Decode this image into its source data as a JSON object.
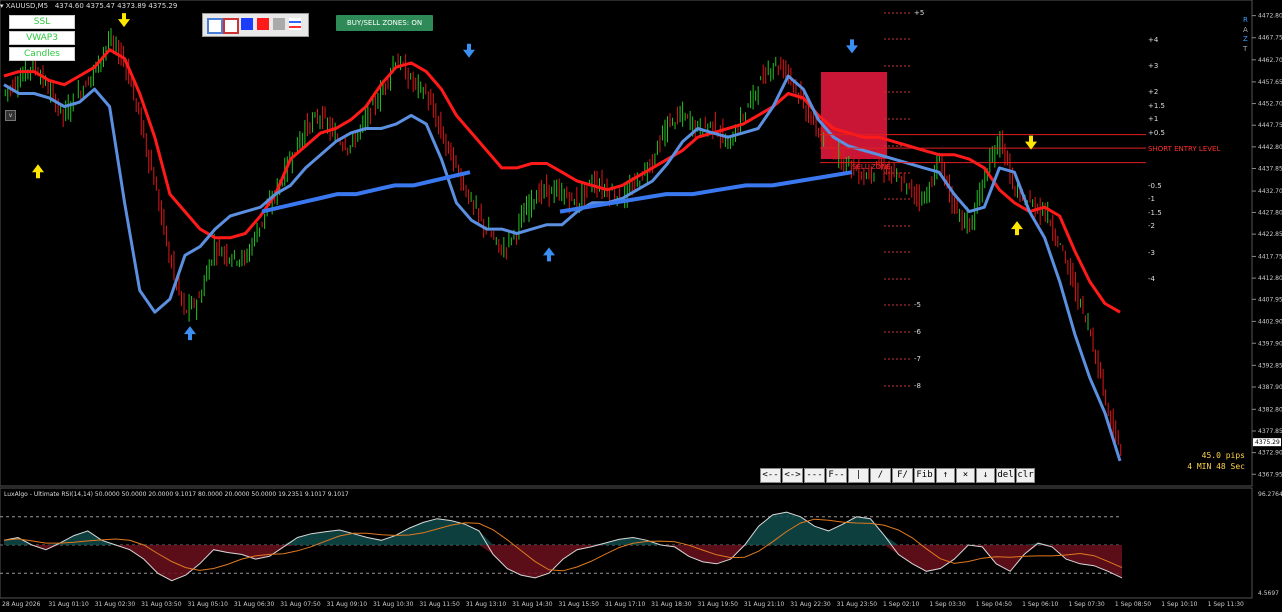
{
  "header": {
    "symbol": "XAUUSD,M5",
    "ohlc": "4374.60 4375.47 4373.89 4375.29"
  },
  "indicator_buttons": [
    "SSL",
    "VWAP3",
    "Candles"
  ],
  "zones_button": "BUY/SELL ZONES: ON",
  "color_swatches": [
    "#ffffff",
    "#ffffff",
    "#1a3cff",
    "#ff1a1a",
    "#bbbbbb",
    "#ff3333"
  ],
  "fib_levels_left": [
    "+5",
    "-5",
    "-6",
    "-7",
    "-8"
  ],
  "fib_levels_right": [
    "+4",
    "+3",
    "+2",
    "+1.5",
    "+1",
    "+0.5",
    "-0.5",
    "-1",
    "-1.5",
    "-2",
    "-3",
    "-4"
  ],
  "short_entry_label": "SHORT ENTRY LEVEL",
  "sell_zone_label": "SELL ZONE",
  "pips": "45.0 pips",
  "timer": "4 MIN 48 Sec",
  "right_fragments": [
    "R",
    "A",
    "Z",
    "T"
  ],
  "toolbar": [
    "<--",
    "<->",
    "---",
    "F--",
    "|",
    "/",
    "F/",
    "Fib",
    "↑",
    "×",
    "↓",
    "del",
    "clr"
  ],
  "rsi_label": "LuxAlgo - Ultimate RSI(14,14) 50.0000 50.0000 20.0000 9.1017 80.0000 20.0000 50.0000 19.2351 9.1017 9.1017",
  "rsi_scale": [
    "96.2764",
    "4.5697"
  ],
  "chart_data": {
    "type": "line",
    "title": "XAUUSD,M5",
    "price_axis": [
      "4472.80",
      "4467.75",
      "4462.70",
      "4457.65",
      "4452.70",
      "4447.75",
      "4442.80",
      "4437.85",
      "4432.70",
      "4427.80",
      "4422.85",
      "4417.75",
      "4412.80",
      "4407.95",
      "4402.90",
      "4397.90",
      "4392.85",
      "4387.90",
      "4382.80",
      "4377.85",
      "4372.90",
      "4367.95"
    ],
    "current_price": "4375.29",
    "ylim": [
      4365.5,
      4475.0
    ],
    "x_labels": [
      "28 Aug 2026",
      "31 Aug 01:10",
      "31 Aug 02:30",
      "31 Aug 03:50",
      "31 Aug 05:10",
      "31 Aug 06:30",
      "31 Aug 07:50",
      "31 Aug 09:10",
      "31 Aug 10:30",
      "31 Aug 11:50",
      "31 Aug 13:10",
      "31 Aug 14:30",
      "31 Aug 15:50",
      "31 Aug 17:10",
      "31 Aug 18:30",
      "31 Aug 19:50",
      "31 Aug 21:10",
      "31 Aug 22:30",
      "31 Aug 23:50",
      "1 Sep 02:10",
      "1 Sep 03:30",
      "1 Sep 04:50",
      "1 Sep 06:10",
      "1 Sep 07:30",
      "1 Sep 08:50",
      "1 Sep 10:10",
      "1 Sep 11:30"
    ],
    "series": [
      {
        "name": "SSL",
        "values": [
          4459,
          4460,
          4460,
          4458,
          4457,
          4459,
          4461,
          4465,
          4463,
          4455,
          4445,
          4432,
          4428,
          4424,
          4422,
          4422,
          4423,
          4427,
          4432,
          4440,
          4443,
          4446,
          4447,
          4449,
          4452,
          4457,
          4461,
          4462,
          4460,
          4456,
          4450,
          4446,
          4442,
          4438,
          4438,
          4439,
          4439,
          4437,
          4435,
          4434,
          4433,
          4434,
          4436,
          4438,
          4440,
          4442,
          4445,
          4446,
          4447,
          4448,
          4450,
          4452,
          4455,
          4454,
          4450,
          4447,
          4446,
          4445,
          4445,
          4444,
          4443,
          4442,
          4441,
          4441,
          4440,
          4438,
          4433,
          4430,
          4428,
          4429,
          4427,
          4419,
          4412,
          4407,
          4405
        ]
      },
      {
        "name": "VWAP3",
        "values": [
          4457,
          4455,
          4455,
          4454,
          4452,
          4453,
          4456,
          4452,
          4430,
          4410,
          4405,
          4408,
          4418,
          4420,
          4424,
          4427,
          4428,
          4429,
          4432,
          4434,
          4438,
          4441,
          4444,
          4446,
          4447,
          4447,
          4448,
          4450,
          4448,
          4440,
          4430,
          4426,
          4424,
          4424,
          4423,
          4424,
          4425,
          4425,
          4428,
          4430,
          4430,
          4431,
          4433,
          4435,
          4439,
          4444,
          4447,
          4446,
          4445,
          4446,
          4447,
          4452,
          4459,
          4456,
          4449,
          4445,
          4443,
          4442,
          4441,
          4440,
          4439,
          4438,
          4437,
          4432,
          4428,
          4429,
          4438,
          4437,
          4428,
          4422,
          4412,
          4400,
          4390,
          4382,
          4371
        ]
      }
    ],
    "candle_close_path": [
      4455,
      4458,
      4462,
      4456,
      4450,
      4455,
      4460,
      4467,
      4463,
      4450,
      4435,
      4418,
      4405,
      4408,
      4420,
      4418,
      4417,
      4425,
      4432,
      4440,
      4447,
      4450,
      4445,
      4443,
      4449,
      4455,
      4463,
      4458,
      4455,
      4446,
      4438,
      4430,
      4424,
      4419,
      4424,
      4431,
      4433,
      4432,
      4430,
      4435,
      4433,
      4431,
      4435,
      4440,
      4448,
      4450,
      4447,
      4448,
      4443,
      4450,
      4457,
      4462,
      4460,
      4452,
      4446,
      4442,
      4439,
      4436,
      4439,
      4436,
      4433,
      4431,
      4440,
      4428,
      4425,
      4436,
      4445,
      4432,
      4430,
      4428,
      4420,
      4410,
      4400,
      4385,
      4372
    ],
    "blue_line": {
      "name": "VWAP",
      "values": [
        4428,
        4429,
        4430,
        4431,
        4432,
        4432,
        4433,
        4434,
        4434,
        4435,
        4436,
        4437
      ]
    },
    "signals_up": [
      4437.0,
      4400.0,
      4418.0,
      4424.0
    ],
    "signals_down": [
      4472.0,
      4465.0,
      4466.0,
      4444.0
    ],
    "short_entry_levels": [
      4445.6,
      4442.5,
      4439.2
    ],
    "rsi": {
      "upper": 80,
      "lower": 20,
      "mid": 50,
      "values": [
        55,
        58,
        50,
        45,
        52,
        60,
        65,
        55,
        50,
        45,
        35,
        20,
        12,
        18,
        30,
        45,
        42,
        40,
        35,
        38,
        48,
        58,
        62,
        64,
        66,
        62,
        58,
        55,
        60,
        68,
        74,
        78,
        76,
        72,
        65,
        40,
        25,
        18,
        15,
        20,
        35,
        45,
        48,
        52,
        56,
        58,
        55,
        50,
        48,
        38,
        32,
        30,
        35,
        50,
        70,
        82,
        85,
        80,
        70,
        65,
        72,
        80,
        78,
        60,
        40,
        30,
        22,
        25,
        35,
        50,
        48,
        30,
        22,
        40,
        52,
        48,
        35,
        30,
        28,
        22,
        15
      ]
    }
  }
}
